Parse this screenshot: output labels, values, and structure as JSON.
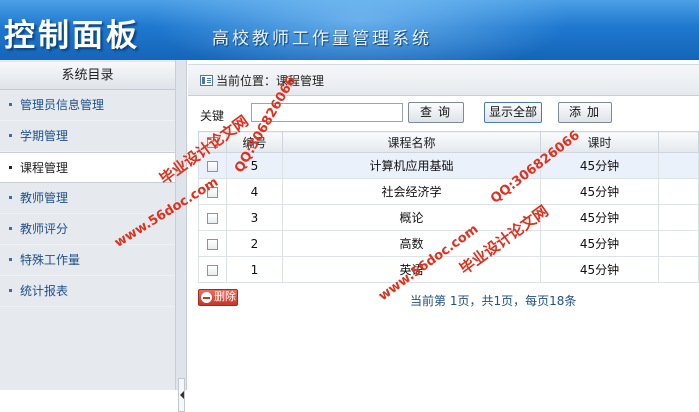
{
  "header": {
    "title": "控制面板",
    "subtitle": "高校教师工作量管理系统"
  },
  "sidebar": {
    "heading": "系统目录",
    "items": [
      {
        "label": "管理员信息管理",
        "active": false
      },
      {
        "label": "学期管理",
        "active": false
      },
      {
        "label": "课程管理",
        "active": true
      },
      {
        "label": "教师管理",
        "active": false
      },
      {
        "label": "教师评分",
        "active": false
      },
      {
        "label": "特殊工作量",
        "active": false
      },
      {
        "label": "统计报表",
        "active": false
      }
    ]
  },
  "breadcrumb": {
    "icon": "list-icon",
    "text": "当前位置：课程管理"
  },
  "toolbar": {
    "keyword_label": "关键",
    "keyword_value": "",
    "search_label": "查询",
    "show_all_label": "显示全部",
    "add_label": "添加"
  },
  "table": {
    "columns": [
      "",
      "编号",
      "课程名称",
      "课时",
      ""
    ],
    "rows": [
      {
        "id": "5",
        "name": "计算机应用基础",
        "hours": "45分钟"
      },
      {
        "id": "4",
        "name": "社会经济学",
        "hours": "45分钟"
      },
      {
        "id": "3",
        "name": "概论",
        "hours": "45分钟"
      },
      {
        "id": "2",
        "name": "高数",
        "hours": "45分钟"
      },
      {
        "id": "1",
        "name": "英语",
        "hours": "45分钟"
      }
    ]
  },
  "footer": {
    "delete_label": "删除",
    "pager_text": "当前第 1页，共1页，每页18条"
  },
  "watermarks": {
    "brand": "毕业设计论文网",
    "qq": "QQ:306826066",
    "url": "www.56doc.com"
  },
  "colors": {
    "header_blue": "#1f78cf",
    "link_blue": "#1e4f8a",
    "delete_red": "#c73525",
    "watermark_red": "#e0301e"
  }
}
